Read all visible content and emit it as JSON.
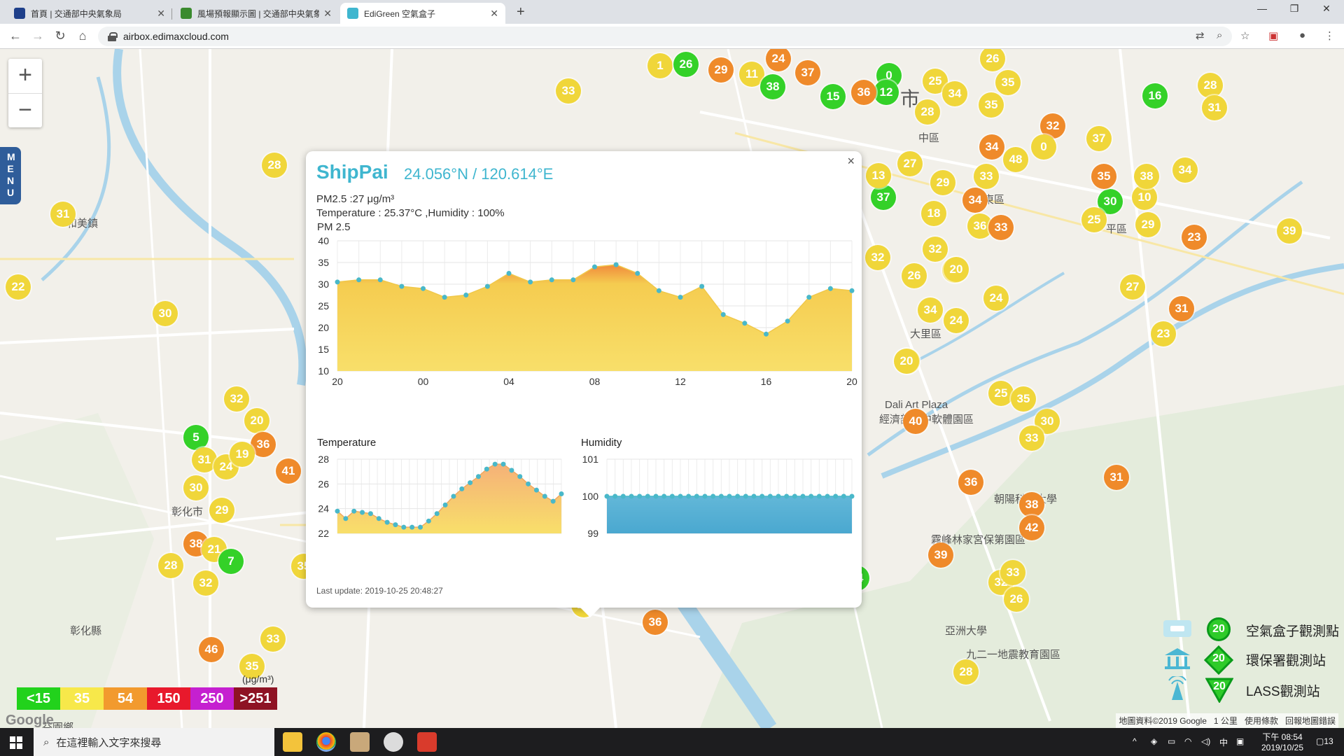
{
  "browser": {
    "tabs": [
      {
        "title": "首頁 | 交通部中央氣象局",
        "active": false
      },
      {
        "title": "風場預報顯示圖 | 交通部中央氣象局",
        "active": false
      },
      {
        "title": "EdiGreen 空氣盒子",
        "active": true
      }
    ],
    "url": "airbox.edimaxcloud.com"
  },
  "map": {
    "zoom_in": "+",
    "zoom_out": "−",
    "menu_label": "MENU",
    "labels": [
      "和美鎮",
      "大里區",
      "中區",
      "東區",
      "霧峰林家宮保第園區",
      "亞洲大學",
      "九二一地震教育園區",
      "彰化縣",
      "芬園鄉",
      "Dali Art Plaza",
      "經濟部台中軟體園區",
      "朝陽科技大學",
      "平區",
      "市",
      "彰化市"
    ],
    "markers_sample": [
      "28",
      "31",
      "22",
      "30",
      "32",
      "20",
      "5",
      "36",
      "41",
      "31",
      "24",
      "19",
      "30",
      "29",
      "38",
      "21",
      "7",
      "28",
      "32",
      "35",
      "46",
      "33",
      "35",
      "27",
      "36",
      "38",
      "14",
      "39",
      "40",
      "36",
      "38",
      "42",
      "31",
      "32",
      "26",
      "33",
      "28",
      "25",
      "35",
      "30",
      "33",
      "30",
      "24",
      "27",
      "31",
      "23",
      "23",
      "39",
      "30",
      "10",
      "29",
      "25",
      "35",
      "38",
      "34",
      "32",
      "37",
      "28",
      "31",
      "16",
      "0",
      "34",
      "48",
      "33",
      "34",
      "36",
      "33",
      "37",
      "13",
      "29",
      "18",
      "27",
      "32",
      "26",
      "20",
      "32",
      "34",
      "24",
      "20",
      "20",
      "0",
      "12",
      "15",
      "36",
      "25",
      "34",
      "28",
      "26",
      "35",
      "35",
      "1",
      "26",
      "29",
      "11",
      "38",
      "37",
      "24",
      "33"
    ]
  },
  "popup": {
    "close": "×",
    "site": "ShipPai",
    "coords": "24.056°N / 120.614°E",
    "pm25_line": "PM2.5 :27 μg/m³",
    "env_line": "Temperature : 25.37°C ,Humidity : 100%",
    "pm_title": "PM 2.5",
    "temp_title": "Temperature",
    "hum_title": "Humidity",
    "last_update": "Last update: 2019-10-25 20:48:27"
  },
  "chart_data": [
    {
      "type": "area",
      "title": "PM 2.5",
      "x": [
        "20",
        "21",
        "22",
        "23",
        "00",
        "01",
        "02",
        "03",
        "04",
        "05",
        "06",
        "07",
        "08",
        "09",
        "10",
        "11",
        "12",
        "13",
        "14",
        "15",
        "16",
        "17",
        "18",
        "19",
        "20"
      ],
      "x_ticks": [
        "20",
        "00",
        "04",
        "08",
        "12",
        "16",
        "20"
      ],
      "values": [
        30.5,
        31,
        31,
        29.5,
        29,
        27,
        27.5,
        29.5,
        32.5,
        30.5,
        31,
        31,
        34,
        34.5,
        32.5,
        28.5,
        27,
        29.5,
        23,
        21,
        18.5,
        21.5,
        27,
        29,
        28.5
      ],
      "ylim": [
        10,
        40
      ],
      "y_ticks": [
        10,
        15,
        20,
        25,
        30,
        35,
        40
      ]
    },
    {
      "type": "area",
      "title": "Temperature",
      "values": [
        23.8,
        23.2,
        23.8,
        23.7,
        23.6,
        23.2,
        22.9,
        22.7,
        22.5,
        22.5,
        22.5,
        23.0,
        23.6,
        24.3,
        25.0,
        25.6,
        26.1,
        26.6,
        27.2,
        27.6,
        27.6,
        27.1,
        26.6,
        26.0,
        25.5,
        25.0,
        24.6,
        25.2
      ],
      "ylim": [
        22,
        28
      ],
      "y_ticks": [
        22,
        24,
        26,
        28
      ]
    },
    {
      "type": "area",
      "title": "Humidity",
      "values": [
        100,
        100,
        100,
        100,
        100,
        100,
        100,
        100,
        100,
        100,
        100,
        100,
        100,
        100,
        100,
        100,
        100,
        100,
        100,
        100,
        100,
        100,
        100,
        100,
        100,
        100,
        100,
        100,
        100,
        100,
        100
      ],
      "ylim": [
        99,
        101
      ],
      "y_ticks": [
        99,
        100,
        101
      ]
    }
  ],
  "legend": {
    "scale": [
      "<15",
      "35",
      "54",
      "150",
      "250",
      ">251"
    ],
    "scale_colors": [
      "#22d21c",
      "#f7e84a",
      "#f29a2e",
      "#e8192c",
      "#c520d0",
      "#8e1324"
    ],
    "unit": "(μg/m³)",
    "google": "Google",
    "items": [
      {
        "label": "空氣盒子觀測點",
        "value": "20"
      },
      {
        "label": "環保署觀測站",
        "value": "20"
      },
      {
        "label": "LASS觀測站",
        "value": "20"
      }
    ],
    "map_copyright": "地圖資料©2019 Google",
    "scale_text": "1 公里",
    "terms": "使用條款",
    "report": "回報地圖錯誤"
  },
  "taskbar": {
    "search_placeholder": "在這裡輸入文字來搜尋",
    "time": "下午 08:54",
    "date": "2019/10/25",
    "ime": "中",
    "notif": "13"
  }
}
